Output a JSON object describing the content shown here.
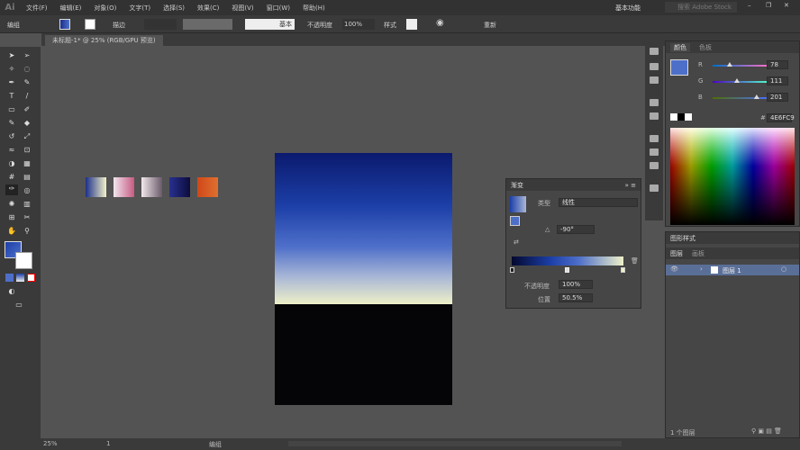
{
  "app": {
    "logo": "Ai"
  },
  "menu": [
    "文件(F)",
    "编辑(E)",
    "对象(O)",
    "文字(T)",
    "选择(S)",
    "效果(C)",
    "视图(V)",
    "窗口(W)",
    "帮助(H)"
  ],
  "workspace": {
    "name": "基本功能",
    "search_placeholder": "搜索 Adobe Stock"
  },
  "control": {
    "selection": "编组",
    "stroke_label": "描边",
    "stroke_profile": "基本",
    "opacity_label": "不透明度",
    "opacity": "100%",
    "style_label": "样式",
    "recolor": "重新"
  },
  "document": {
    "tab": "未标题-1* @ 25% (RGB/GPU 预览)"
  },
  "colors": {
    "accent": "#4e6fc9",
    "ui_bg": "#535353",
    "panel": "#464646"
  },
  "swatches": [
    {
      "from": "#1c2f8a",
      "to": "#f4f2c8"
    },
    {
      "from": "#f0e6ee",
      "to": "#c85a82"
    },
    {
      "from": "#f2e8ec",
      "to": "#6a5a6a"
    },
    {
      "from": "#283090",
      "to": "#0c0c3c"
    },
    {
      "from": "#d04818",
      "to": "#e07030"
    }
  ],
  "gradient_panel": {
    "title": "渐变",
    "type_label": "类型",
    "type": "线性",
    "angle": "-90°",
    "opacity_label": "不透明度",
    "opacity": "100%",
    "location_label": "位置",
    "location": "50.5%"
  },
  "color_panel": {
    "tabs": [
      "颜色",
      "色板"
    ],
    "r_label": "R",
    "r": "78",
    "g_label": "G",
    "g": "111",
    "b_label": "B",
    "b": "201",
    "hex_label": "#",
    "hex": "4E6FC9",
    "r_level": 78,
    "g_level": 111,
    "b_level": 201
  },
  "layers_panel": {
    "title": "图形样式",
    "tabs": [
      "图层",
      "画板"
    ],
    "layer_name": "图层 1",
    "footer": "1 个图层"
  },
  "status": {
    "zoom": "25%",
    "artboard": "1",
    "tool": "编组"
  }
}
